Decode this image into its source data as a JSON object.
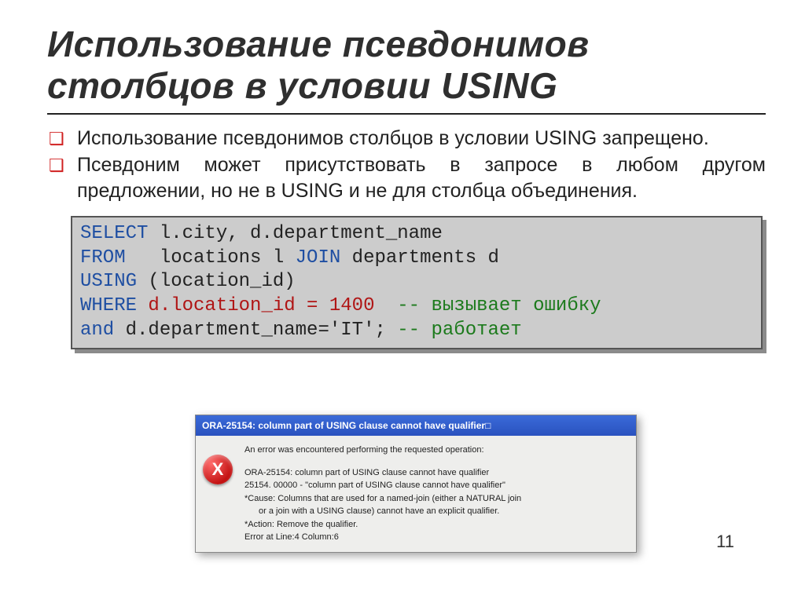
{
  "title": "Использование псевдонимов столбцов в условии USING",
  "bullets": [
    "Использование псевдонимов столбцов в условии USING запрещено.",
    "Псевдоним может присутствовать в запросе в любом другом предложении, но не в USING и не для столбца объединения."
  ],
  "code": {
    "line1a": "SELECT",
    "line1b": " l.city, d.department_name",
    "line2a": "FROM",
    "line2b": "   locations l ",
    "line2c": "JOIN",
    "line2d": " departments d",
    "line3a": "USING",
    "line3b": " (location_id)",
    "line4a": "WHERE",
    "line4b": " ",
    "line4err": "d.location_id = 1400",
    "line4c": "  ",
    "line4cmt": "-- вызывает ошибку",
    "line5a": "and",
    "line5b": " d.department_name='IT'; ",
    "line5cmt": "-- работает"
  },
  "dialog": {
    "titlebar": "ORA-25154: column part of USING clause cannot have qualifier□",
    "lead": "An error was encountered performing the requested operation:",
    "l1": "ORA-25154: column part of USING clause cannot have qualifier",
    "l2": "25154. 00000 -  \"column part of USING clause cannot have qualifier\"",
    "l3a": "*Cause:    Columns that are used for a named-join (either a NATURAL join",
    "l3b": "or a join with a USING clause) cannot have an explicit qualifier.",
    "l4": "*Action:   Remove the qualifier.",
    "l5": "Error at Line:4 Column:6"
  },
  "page_number": "11"
}
